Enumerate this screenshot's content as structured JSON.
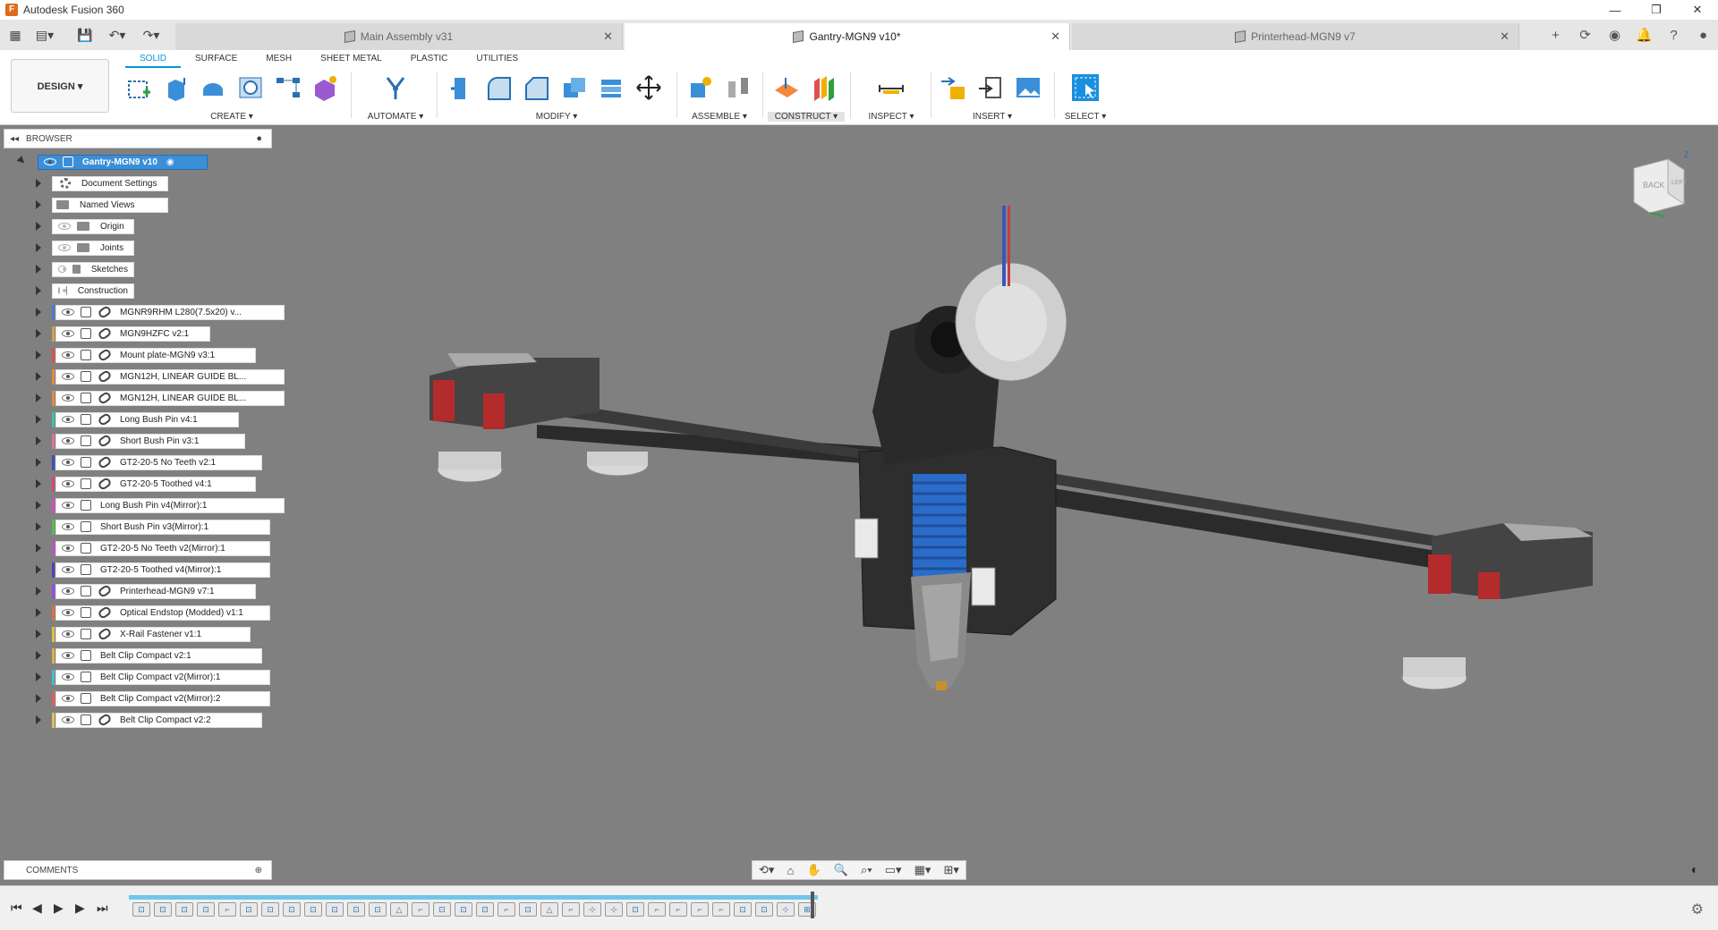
{
  "app": {
    "title": "Autodesk Fusion 360"
  },
  "tabs": [
    {
      "label": "Main Assembly v31",
      "active": false
    },
    {
      "label": "Gantry-MGN9 v10*",
      "active": true
    },
    {
      "label": "Printerhead-MGN9 v7",
      "active": false
    }
  ],
  "ribbon": {
    "workspace": "DESIGN ▾",
    "tabs": [
      "SOLID",
      "SURFACE",
      "MESH",
      "SHEET METAL",
      "PLASTIC",
      "UTILITIES"
    ],
    "groups": {
      "create": "CREATE ▾",
      "automate": "AUTOMATE ▾",
      "modify": "MODIFY ▾",
      "assemble": "ASSEMBLE ▾",
      "construct": "CONSTRUCT ▾",
      "inspect": "INSPECT ▾",
      "insert": "INSERT ▾",
      "select": "SELECT ▾"
    }
  },
  "browser": {
    "title": "BROWSER",
    "root": "Gantry-MGN9 v10",
    "folders": [
      "Document Settings",
      "Named Views",
      "Origin",
      "Joints",
      "Sketches",
      "Construction"
    ],
    "components": [
      {
        "label": "MGNR9RHM L280(7.5x20) v...",
        "color": "#4a7bd8"
      },
      {
        "label": "MGN9HZFC v2:1",
        "color": "#d8a04a"
      },
      {
        "label": "Mount plate-MGN9 v3:1",
        "color": "#e05050"
      },
      {
        "label": "MGN12H, LINEAR GUIDE BL...",
        "color": "#e88a3a"
      },
      {
        "label": "MGN12H, LINEAR GUIDE BL...",
        "color": "#e88a3a"
      },
      {
        "label": "Long Bush Pin v4:1",
        "color": "#3ac0b0"
      },
      {
        "label": "Short Bush Pin v3:1",
        "color": "#e070a0"
      },
      {
        "label": "GT2-20-5 No Teeth v2:1",
        "color": "#3a50c0"
      },
      {
        "label": "GT2-20-5 Toothed v4:1",
        "color": "#e04080"
      },
      {
        "label": "Long Bush Pin v4(Mirror):1",
        "color": "#d050c0"
      },
      {
        "label": "Short Bush Pin v3(Mirror):1",
        "color": "#50c050"
      },
      {
        "label": "GT2-20-5 No Teeth v2(Mirror):1",
        "color": "#c050d0"
      },
      {
        "label": "GT2-20-5 Toothed v4(Mirror):1",
        "color": "#5040c0"
      },
      {
        "label": "Printerhead-MGN9 v7:1",
        "color": "#9050e0"
      },
      {
        "label": "Optical Endstop (Modded) v1:1",
        "color": "#e07040"
      },
      {
        "label": "X-Rail Fastener v1:1",
        "color": "#e0c040"
      },
      {
        "label": "Belt Clip Compact v2:1",
        "color": "#e0b040"
      },
      {
        "label": "Belt Clip Compact v2(Mirror):1",
        "color": "#40c0d0"
      },
      {
        "label": "Belt Clip Compact v2(Mirror):2",
        "color": "#e06060"
      },
      {
        "label": "Belt Clip Compact v2:2",
        "color": "#e0c060"
      }
    ]
  },
  "comments": {
    "title": "COMMENTS"
  },
  "viewcube": {
    "face_back": "BACK",
    "face_left": "LEFT",
    "axis_z": "Z"
  }
}
